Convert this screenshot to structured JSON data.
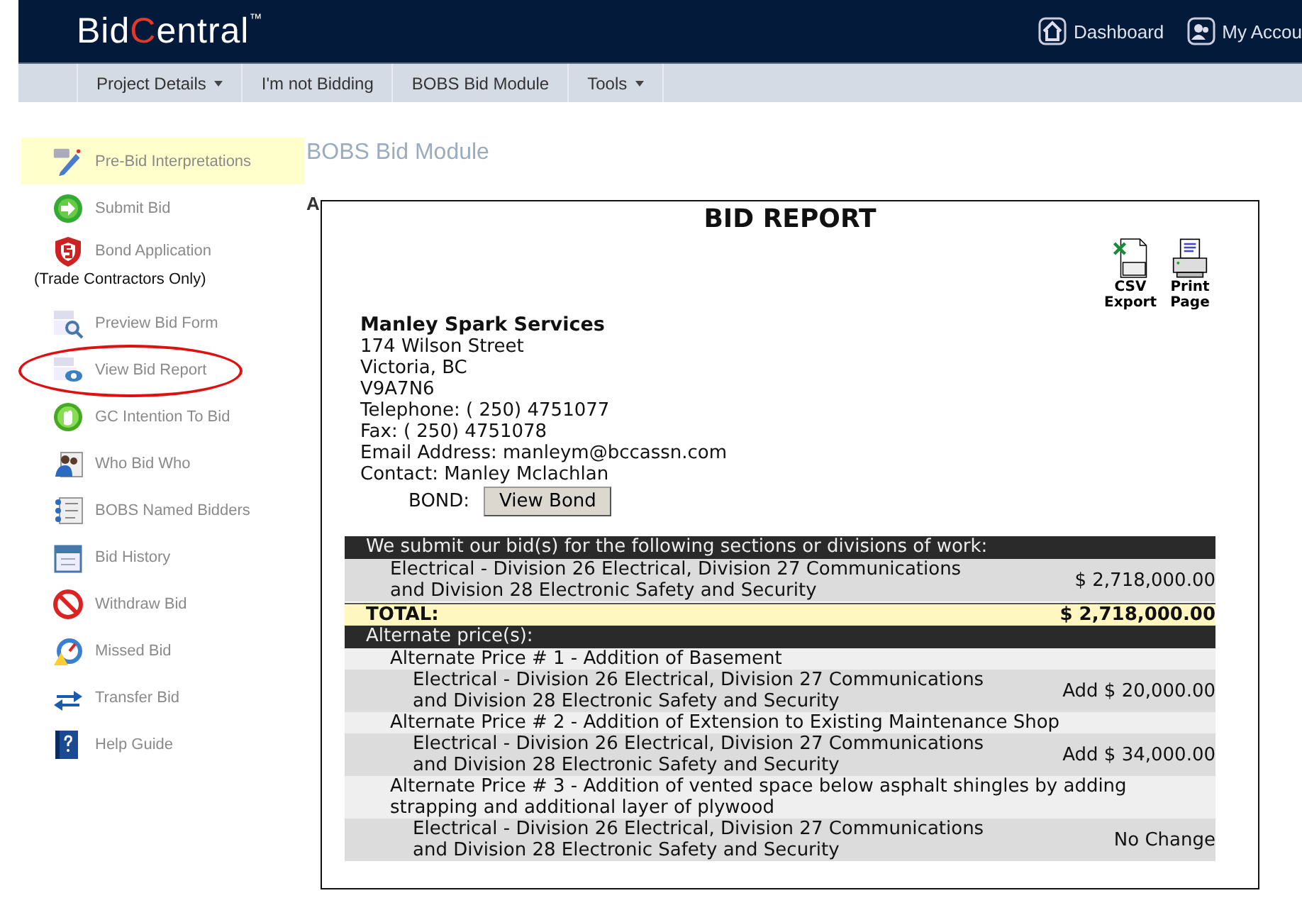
{
  "header": {
    "logo": [
      {
        "text": "Bid",
        "accent": false
      },
      {
        "text": "C",
        "accent": true
      },
      {
        "text": "entral",
        "accent": false
      }
    ],
    "trademark": "™",
    "links": [
      {
        "label": "Dashboard"
      },
      {
        "label": "My Accou"
      }
    ]
  },
  "subnav": [
    {
      "label": "Project Details",
      "dropdown": true
    },
    {
      "label": "I'm not Bidding",
      "dropdown": false
    },
    {
      "label": "BOBS Bid Module",
      "dropdown": false
    },
    {
      "label": "Tools",
      "dropdown": true
    }
  ],
  "sidebar": {
    "items": [
      {
        "label": "Pre-Bid Interpretations",
        "selected": true,
        "circled": false
      },
      {
        "label": "Submit Bid",
        "selected": false,
        "circled": false
      },
      {
        "label": "Bond Application",
        "selected": false,
        "circled": false,
        "note": "(Trade Contractors Only)"
      },
      {
        "label": "Preview Bid Form",
        "selected": false,
        "circled": false
      },
      {
        "label": "View Bid Report",
        "selected": false,
        "circled": true
      },
      {
        "label": "GC Intention To Bid",
        "selected": false,
        "circled": false
      },
      {
        "label": "Who Bid Who",
        "selected": false,
        "circled": false
      },
      {
        "label": "BOBS Named Bidders",
        "selected": false,
        "circled": false
      },
      {
        "label": "Bid History",
        "selected": false,
        "circled": false
      },
      {
        "label": "Withdraw Bid",
        "selected": false,
        "circled": false
      },
      {
        "label": "Missed Bid",
        "selected": false,
        "circled": false
      },
      {
        "label": "Transfer Bid",
        "selected": false,
        "circled": false
      },
      {
        "label": "Help Guide",
        "selected": false,
        "circled": false
      }
    ]
  },
  "page_title": "BOBS Bid Module",
  "page_text": "A",
  "report": {
    "title": "BID REPORT",
    "tools": [
      {
        "label": "CSV Export"
      },
      {
        "label": "Print Page"
      }
    ],
    "company": "Manley Spark Services",
    "address_lines": [
      "174 Wilson Street",
      "Victoria, BC",
      "V9A7N6",
      "Telephone: ( 250) 4751077",
      "Fax: ( 250) 4751078",
      "Email Address: manleym@bccassn.com",
      "Contact: Manley Mclachlan"
    ],
    "bond_label": "BOND:",
    "bond_button": "View Bond",
    "sections": {
      "heading": "We submit our bid(s) for the following sections or divisions of work:",
      "items": [
        {
          "description": "Electrical - Division 26 Electrical, Division 27 Communications and Division 28 Electronic Safety and Security",
          "amount": "$ 2,718,000.00"
        }
      ]
    },
    "total": {
      "label": "TOTAL:",
      "amount": "$ 2,718,000.00"
    },
    "alternates": {
      "heading": "Alternate price(s):",
      "items": [
        {
          "title": "Alternate Price # 1 - Addition of Basement",
          "children": [
            {
              "description": "Electrical - Division 26 Electrical, Division 27 Communications and Division 28 Electronic Safety and Security",
              "amount": "Add $ 20,000.00"
            }
          ]
        },
        {
          "title": "Alternate Price # 2 - Addition of Extension to Existing Maintenance Shop",
          "children": [
            {
              "description": "Electrical - Division 26 Electrical, Division 27 Communications and Division 28 Electronic Safety and Security",
              "amount": "Add $ 34,000.00"
            }
          ]
        },
        {
          "title": "Alternate Price # 3 - Addition of vented space below asphalt shingles by adding strapping and additional layer of plywood",
          "children": [
            {
              "description": "Electrical - Division 26 Electrical, Division 27 Communications and Division 28 Electronic Safety and Security",
              "amount": "No Change"
            }
          ]
        }
      ]
    }
  }
}
